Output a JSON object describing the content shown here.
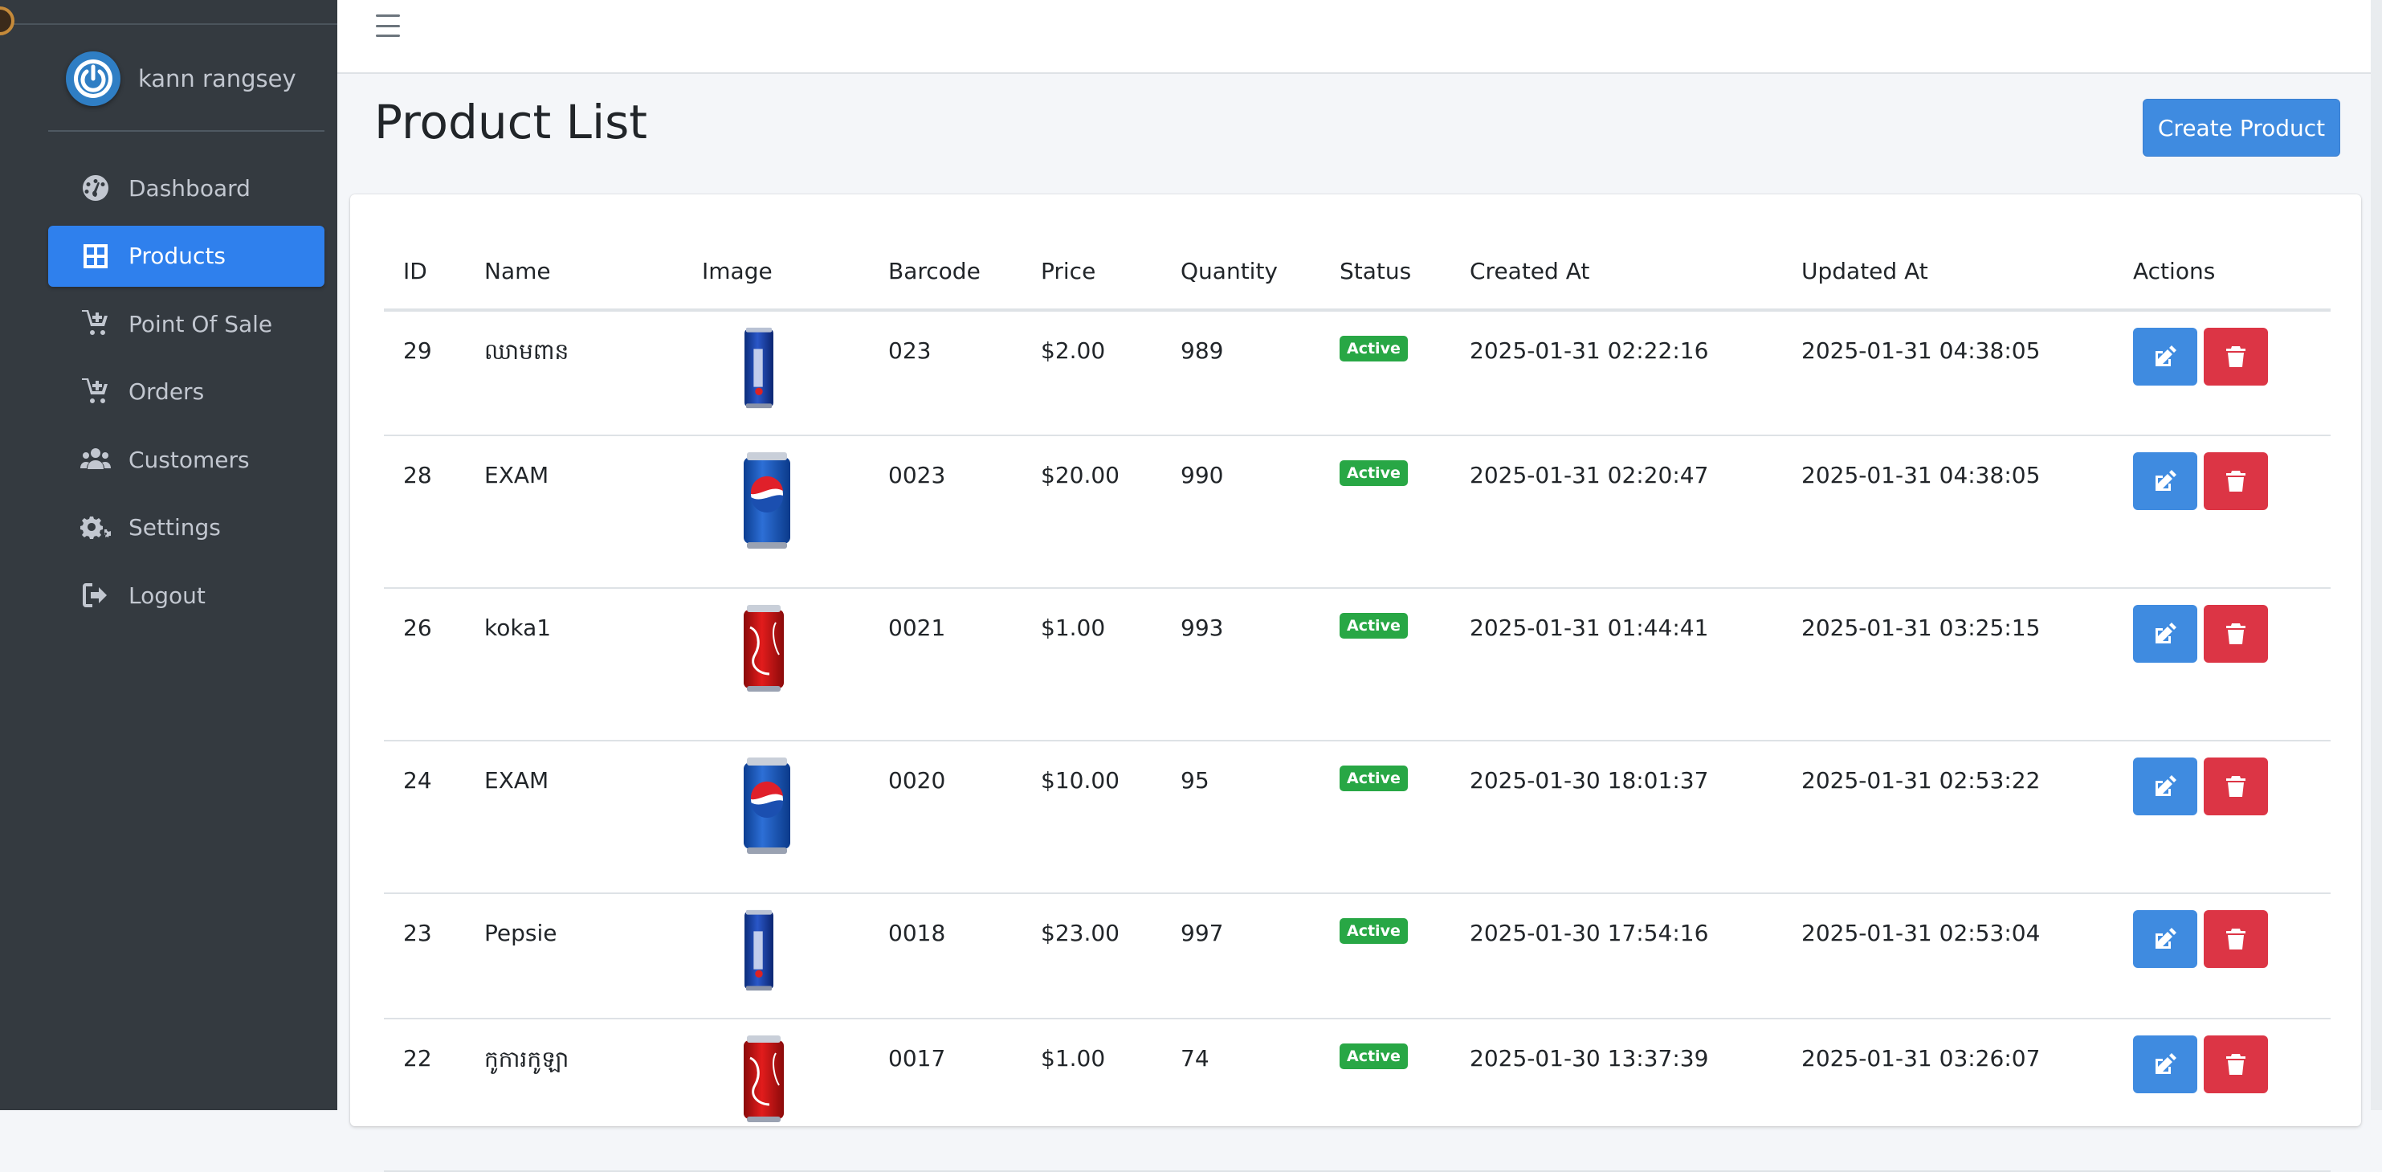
{
  "user": {
    "name": "kann rangsey"
  },
  "nav": {
    "items": [
      {
        "label": "Dashboard",
        "icon": "dashboard-icon"
      },
      {
        "label": "Products",
        "icon": "grid-icon",
        "active": true
      },
      {
        "label": "Point Of Sale",
        "icon": "cart-plus-icon"
      },
      {
        "label": "Orders",
        "icon": "cart-plus-icon"
      },
      {
        "label": "Customers",
        "icon": "users-icon"
      },
      {
        "label": "Settings",
        "icon": "gears-icon"
      },
      {
        "label": "Logout",
        "icon": "logout-icon"
      }
    ]
  },
  "page": {
    "title": "Product List",
    "create_label": "Create Product"
  },
  "table": {
    "headers": [
      "ID",
      "Name",
      "Image",
      "Barcode",
      "Price",
      "Quantity",
      "Status",
      "Created At",
      "Updated At",
      "Actions"
    ],
    "rows": [
      {
        "id": "29",
        "name": "ឈាមពាន",
        "image": "blue-slim-can",
        "barcode": "023",
        "price": "$2.00",
        "quantity": "989",
        "status": "Active",
        "created": "2025-01-31 02:22:16",
        "updated": "2025-01-31 04:38:05"
      },
      {
        "id": "28",
        "name": "EXAM",
        "image": "pepsi-can",
        "barcode": "0023",
        "price": "$20.00",
        "quantity": "990",
        "status": "Active",
        "created": "2025-01-31 02:20:47",
        "updated": "2025-01-31 04:38:05"
      },
      {
        "id": "26",
        "name": "koka1",
        "image": "coca-cola-can",
        "barcode": "0021",
        "price": "$1.00",
        "quantity": "993",
        "status": "Active",
        "created": "2025-01-31 01:44:41",
        "updated": "2025-01-31 03:25:15"
      },
      {
        "id": "24",
        "name": "EXAM",
        "image": "pepsi-can",
        "barcode": "0020",
        "price": "$10.00",
        "quantity": "95",
        "status": "Active",
        "created": "2025-01-30 18:01:37",
        "updated": "2025-01-31 02:53:22"
      },
      {
        "id": "23",
        "name": "Pepsie",
        "image": "blue-slim-can",
        "barcode": "0018",
        "price": "$23.00",
        "quantity": "997",
        "status": "Active",
        "created": "2025-01-30 17:54:16",
        "updated": "2025-01-31 02:53:04"
      },
      {
        "id": "22",
        "name": "កូការកូឡា",
        "image": "coca-cola-can",
        "barcode": "0017",
        "price": "$1.00",
        "quantity": "74",
        "status": "Active",
        "created": "2025-01-30 13:37:39",
        "updated": "2025-01-31 03:26:07"
      }
    ]
  },
  "colors": {
    "sidebar": "#343a40",
    "primary": "#3f8be0",
    "danger": "#dc3545",
    "success": "#28a745"
  }
}
